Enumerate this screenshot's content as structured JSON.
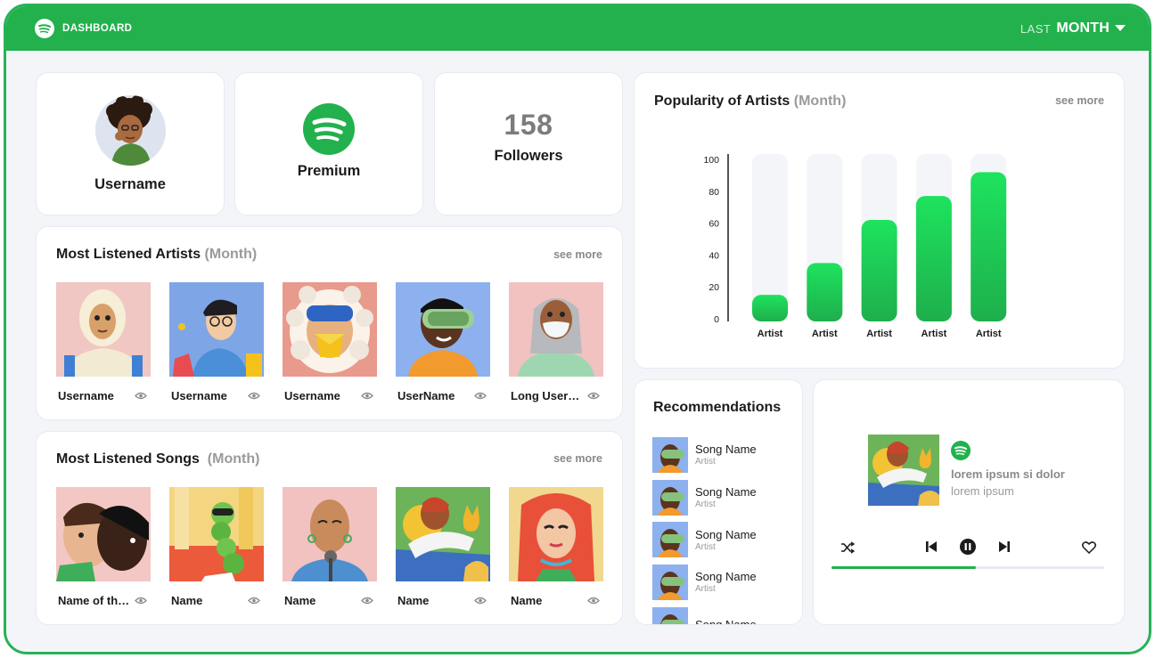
{
  "header": {
    "title": "DASHBOARD",
    "range_prefix": "LAST",
    "range_value": "MONTH"
  },
  "profile": {
    "username": "Username"
  },
  "plan": {
    "label": "Premium"
  },
  "followers": {
    "count": "158",
    "label": "Followers"
  },
  "artists_section": {
    "title": "Most Listened Artists",
    "period": "(Month)",
    "see_more": "see more",
    "items": [
      {
        "name": "Username"
      },
      {
        "name": "Username"
      },
      {
        "name": "Username"
      },
      {
        "name": "UserName"
      },
      {
        "name": "Long Username"
      }
    ]
  },
  "songs_section": {
    "title": "Most Listened Songs",
    "period": "(Month)",
    "see_more": "see more",
    "items": [
      {
        "name": "Name of the song"
      },
      {
        "name": "Name"
      },
      {
        "name": "Name"
      },
      {
        "name": "Name"
      },
      {
        "name": "Name"
      }
    ]
  },
  "popularity": {
    "title": "Popularity of Artists",
    "period": "(Month)",
    "see_more": "see more"
  },
  "chart_data": {
    "type": "bar",
    "categories": [
      "Artist",
      "Artist",
      "Artist",
      "Artist",
      "Artist"
    ],
    "values": [
      15,
      35,
      62,
      77,
      92
    ],
    "ylim": [
      0,
      100
    ],
    "yticks": [
      0,
      20,
      40,
      60,
      80,
      100
    ],
    "grid": false,
    "colors": {
      "bar_top": "#1ee35e",
      "bar_bottom": "#1eaf4c",
      "track": "#f3f5f9"
    }
  },
  "recommendations": {
    "title": "Recommendations",
    "items": [
      {
        "song": "Song Name",
        "artist": "Artist"
      },
      {
        "song": "Song Name",
        "artist": "Artist"
      },
      {
        "song": "Song Name",
        "artist": "Artist"
      },
      {
        "song": "Song Name",
        "artist": "Artist"
      },
      {
        "song": "Song Name",
        "artist": ""
      }
    ]
  },
  "player": {
    "track_title": "lorem ipsum si dolor",
    "track_subtitle": "lorem ipsum",
    "progress": 0.53,
    "icons": [
      "shuffle-icon",
      "previous-icon",
      "pause-icon",
      "next-icon",
      "heart-icon"
    ]
  },
  "colors": {
    "brand_green": "#22b14c",
    "page_bg": "#f3f5f9",
    "muted_text": "#9a9a9a"
  }
}
